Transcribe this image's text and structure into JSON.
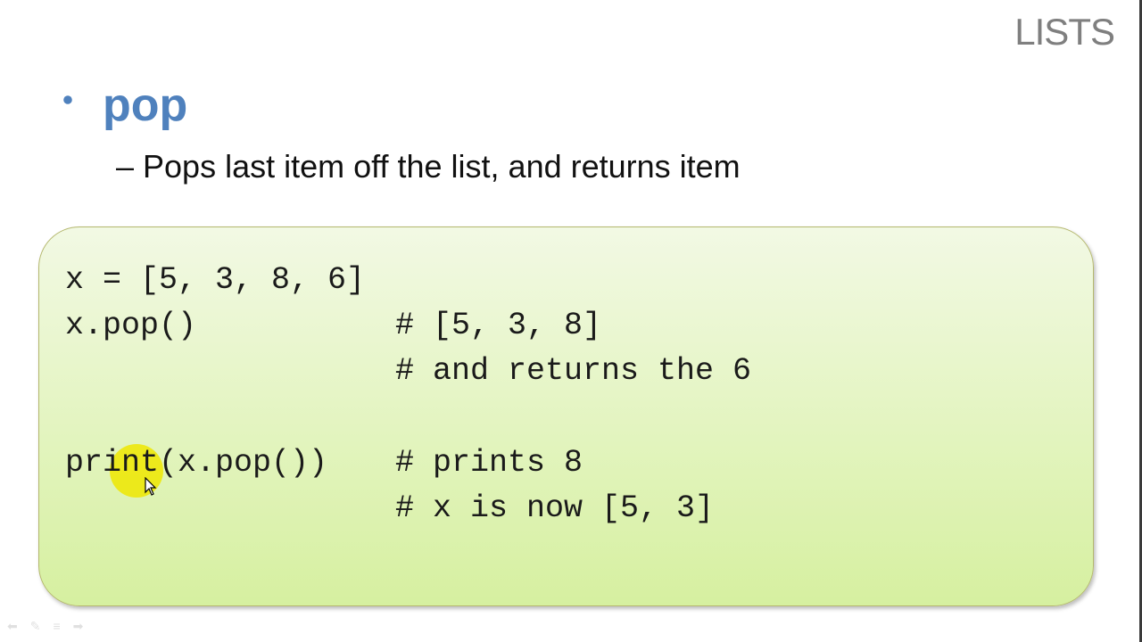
{
  "section_title": "LISTS",
  "heading": "pop",
  "subtext": "– Pops last item off the list, and returns item",
  "code_lines": [
    {
      "code": "x = [5, 3, 8, 6]",
      "comment": ""
    },
    {
      "code": "x.pop()",
      "comment": "# [5, 3, 8]"
    },
    {
      "code": "",
      "comment": "# and returns the 6"
    },
    {
      "code": "",
      "comment": ""
    },
    {
      "code": "print(x.pop())",
      "comment": "# prints 8"
    },
    {
      "code": "",
      "comment": "# x is now [5, 3]"
    }
  ],
  "colors": {
    "accent": "#4f81bd",
    "section": "#7f7f7f"
  }
}
